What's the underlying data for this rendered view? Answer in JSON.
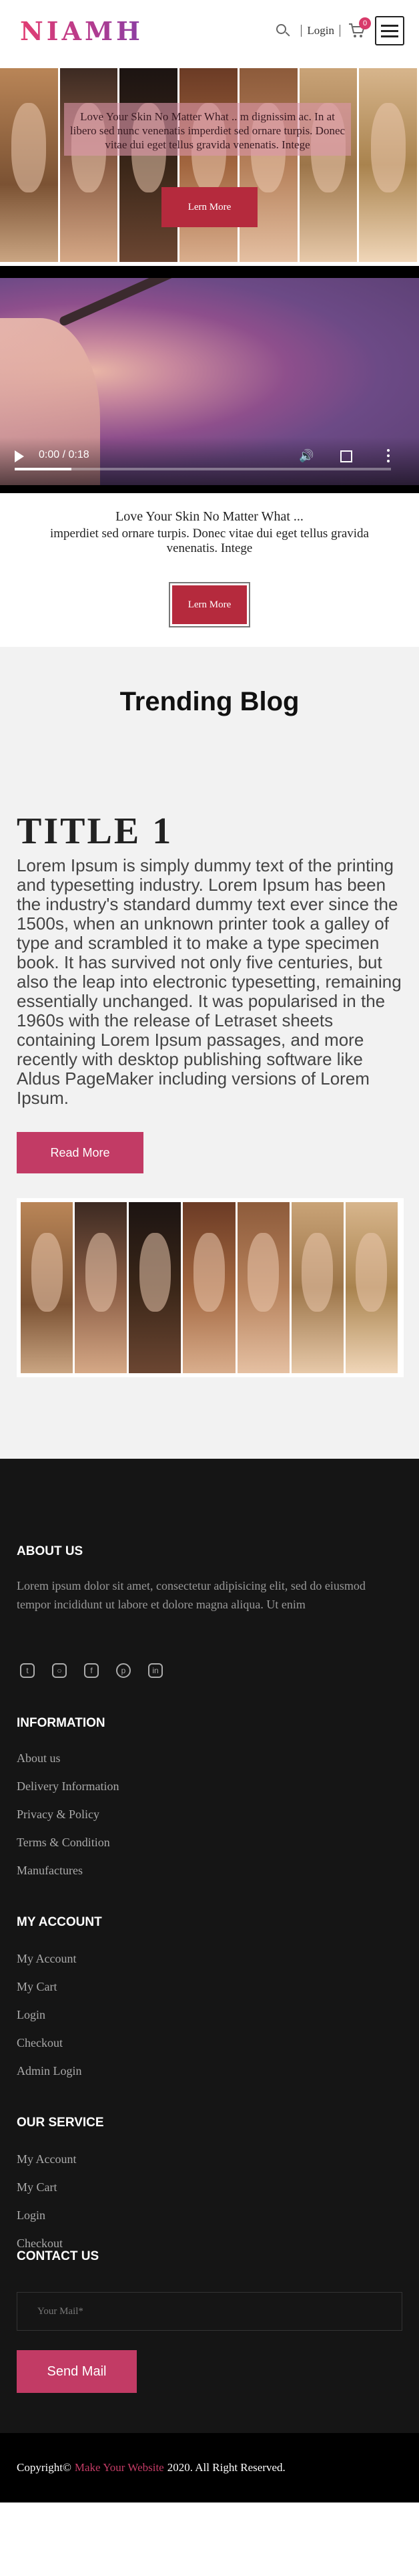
{
  "header": {
    "logo": "NIAMH",
    "login_label": "Login",
    "cart_count": "0",
    "icons": [
      "search-icon",
      "cart-icon",
      "hamburger-menu-icon"
    ]
  },
  "hero": {
    "text": "Love Your Skin No Matter What .. m dignissim ac. In at libero sed nunc venenatis imperdiet sed ornare turpis. Donec vitae dui eget tellus gravida venenatis. Integе",
    "button_label": "Lern More"
  },
  "video": {
    "time": "0:00 / 0:18",
    "progress": 0.15
  },
  "promo": {
    "line": "Love Your Skin No Matter What ...",
    "text": "imperdiet sed ornare turpis. Donec vitae dui eget tellus gravida venenatis. Intege",
    "button_label": "Lern More"
  },
  "blog": {
    "section_title": "Trending Blog",
    "post_title": "TITLE 1",
    "post_body": "Lorem Ipsum is simply dummy text of the printing and typesetting industry. Lorem Ipsum has been the industry's standard dummy text ever since the 1500s, when an unknown printer took a galley of type and scrambled it to make a type specimen book. It has survived not only five centuries, but also the leap into electronic typesetting, remaining essentially unchanged. It was popularised in the 1960s with the release of Letraset sheets containing Lorem Ipsum passages, and more recently with desktop publishing software like Aldus PageMaker including versions of Lorem Ipsum.",
    "read_more": "Read More"
  },
  "footer": {
    "about": {
      "heading": "ABOUT US",
      "text": "Lorem ipsum dolor sit amet, consectetur adipisicing elit, sed do eiusmod tempor incididunt ut labore et dolore magna aliqua. Ut enim"
    },
    "social_icons": [
      "twitter-icon",
      "instagram-icon",
      "facebook-icon",
      "pinterest-icon",
      "linkedin-icon"
    ],
    "information": {
      "heading": "INFORMATION",
      "links": [
        "About us",
        "Delivery Information",
        "Privacy & Policy",
        "Terms & Condition",
        "Manufactures"
      ]
    },
    "my_account": {
      "heading": "MY ACCOUNT",
      "links": [
        "My Account",
        "My Cart",
        "Login",
        "Checkout",
        "Admin Login"
      ]
    },
    "our_service": {
      "heading": "OUR SERVICE",
      "links": [
        "My Account",
        "My Cart",
        "Login",
        "Checkout"
      ]
    },
    "contact": {
      "heading": "CONTACT US",
      "placeholder": "Your Mail*",
      "button_label": "Send Mail"
    },
    "copyright": {
      "prefix": "Copyright©",
      "highlight": "Make Your Website",
      "suffix": "2020. All Right Reserved."
    }
  },
  "colors": {
    "accent": "#c23b65",
    "hero_button": "#b52a3d",
    "footer_bg": "#151515"
  }
}
